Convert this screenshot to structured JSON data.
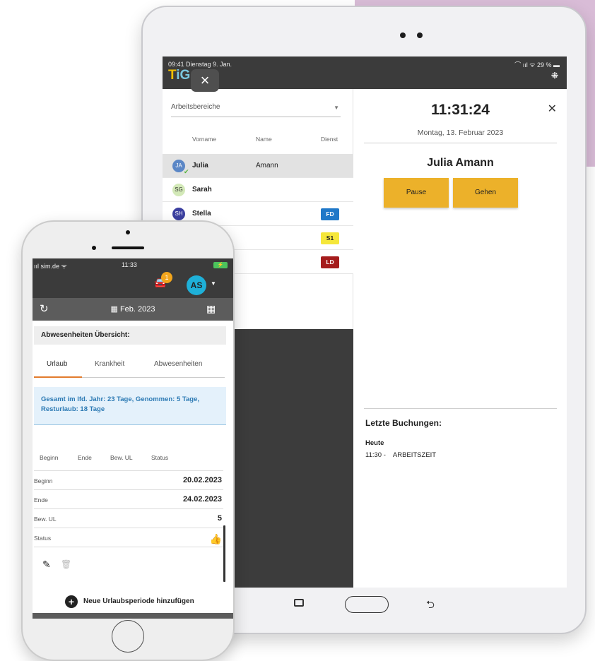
{
  "tablet": {
    "status_time": "09:41  Dienstag 9. Jan.",
    "status_right": "⌒ ııl ᯤ 29 % ▬",
    "logo_first": "T",
    "logo_rest": "iG",
    "close_icon": "×",
    "expand_icon": "⁜",
    "left": {
      "areas_label": "Arbeitsbereiche",
      "headers": {
        "first": "Vorname",
        "last": "Name",
        "shift": "Dienst"
      },
      "rows": [
        {
          "initials": "JA",
          "first": "Julia",
          "last": "Amann",
          "badge": "",
          "selected": true
        },
        {
          "initials": "SG",
          "first": "Sarah",
          "last": "",
          "badge": ""
        },
        {
          "initials": "SH",
          "first": "Stella",
          "last": "",
          "badge": "FD"
        },
        {
          "initials": "",
          "first": "",
          "last": "",
          "badge": "S1"
        },
        {
          "initials": "",
          "first": "",
          "last": "",
          "badge": "LD"
        }
      ]
    },
    "right": {
      "clock": "11:31:24",
      "date": "Montag, 13. Februar 2023",
      "person": "Julia Amann",
      "pause": "Pause",
      "leave": "Gehen",
      "bookings_title": "Letzte Buchungen:",
      "bookings_day": "Heute",
      "booking_time": "11:30 -",
      "booking_type": "ARBEITSZEIT"
    }
  },
  "phone": {
    "carrier": "sim.de",
    "time": "11:33",
    "battery": "⚡",
    "notif_count": "1",
    "avatar": "AS",
    "month": "Feb. 2023",
    "overview_title": "Abwesenheiten Übersicht:",
    "tabs": [
      "Urlaub",
      "Krankheit",
      "Abwesenheiten"
    ],
    "info": "Gesamt im lfd. Jahr: 23 Tage, Genommen: 5 Tage, Resturlaub: 18 Tage",
    "headers": [
      "Beginn",
      "Ende",
      "Bew. UL",
      "Status"
    ],
    "rows": [
      {
        "k": "Beginn",
        "v": "20.02.2023"
      },
      {
        "k": "Ende",
        "v": "24.02.2023"
      },
      {
        "k": "Bew. UL",
        "v": "5"
      },
      {
        "k": "Status",
        "v": ""
      }
    ],
    "add_label": "Neue Urlaubsperiode hinzufügen"
  },
  "colors": {
    "accent_button": "#ecb12a",
    "tab_active": "#e27b2c",
    "info_text": "#2c7ab4",
    "badge_fd": "#1f78c8",
    "badge_s1": "#f5e73a",
    "badge_ld": "#a51c1c"
  }
}
